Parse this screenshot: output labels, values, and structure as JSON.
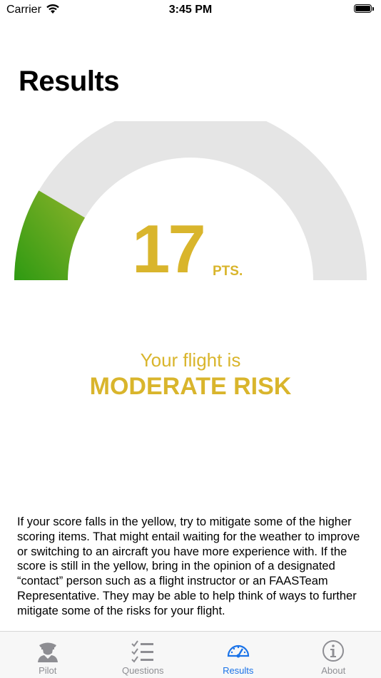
{
  "status_bar": {
    "carrier": "Carrier",
    "time": "3:45 PM"
  },
  "page": {
    "title": "Results"
  },
  "score": {
    "value": "17",
    "unit": "PTS.",
    "gauge_fraction": 0.17,
    "gauge_color": "#4a9e1c",
    "track_color": "#e5e5e5"
  },
  "result": {
    "prefix": "Your flight is",
    "risk_level": "MODERATE RISK",
    "color": "#d9b52c"
  },
  "advice": "If your score falls in the yellow, try to mitigate some of the higher scoring items. That might entail waiting for the weather to improve or switching to an aircraft you have more experience with. If the score is still in the yellow, bring in the opinion of a designated “contact” person such as a flight instructor or an FAASTeam Representative. They may be able to help think of ways to further mitigate some of the risks for your flight.",
  "tabs": [
    {
      "label": "Pilot",
      "icon": "pilot-icon",
      "active": false
    },
    {
      "label": "Questions",
      "icon": "checklist-icon",
      "active": false
    },
    {
      "label": "Results",
      "icon": "speedometer-icon",
      "active": true
    },
    {
      "label": "About",
      "icon": "info-icon",
      "active": false
    }
  ],
  "colors": {
    "accent": "#1a73e8",
    "inactive": "#8e8e93"
  }
}
